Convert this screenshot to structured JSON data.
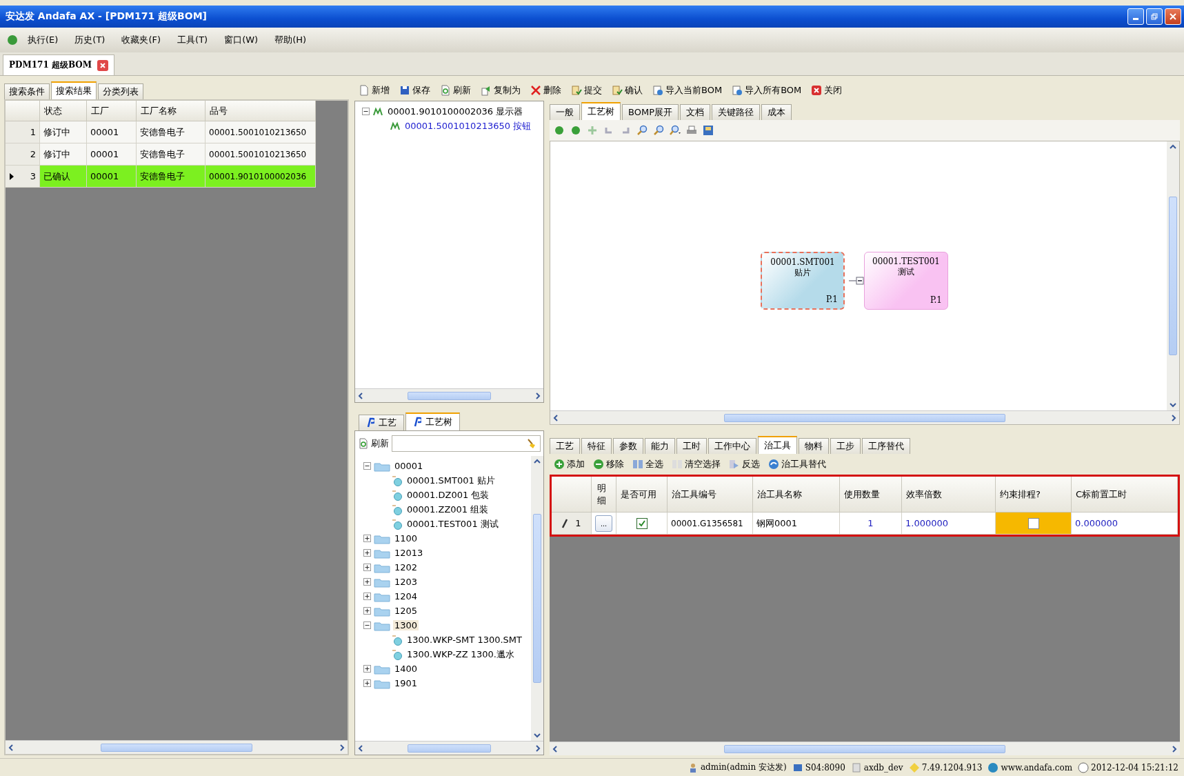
{
  "window": {
    "title": "安达发 Andafa AX - [PDM171 超级BOM]"
  },
  "menu": [
    {
      "label": "执行(E)"
    },
    {
      "label": "历史(T)"
    },
    {
      "label": "收藏夹(F)"
    },
    {
      "label": "工具(T)"
    },
    {
      "label": "窗口(W)"
    },
    {
      "label": "帮助(H)"
    }
  ],
  "doc_tabs": [
    {
      "label": "PDM171 超级BOM",
      "selected": true
    }
  ],
  "left_panel": {
    "tabs": [
      {
        "label": "搜索条件",
        "selected": false
      },
      {
        "label": "搜索结果",
        "selected": true
      },
      {
        "label": "分类列表",
        "selected": false
      }
    ],
    "table": {
      "columns": [
        "状态",
        "工厂",
        "工厂名称",
        "品号"
      ],
      "rows": [
        {
          "index": "1",
          "selected": false,
          "cells": [
            "修订中",
            "00001",
            "安德鲁电子",
            "00001.5001010213650"
          ]
        },
        {
          "index": "2",
          "selected": false,
          "cells": [
            "修订中",
            "00001",
            "安德鲁电子",
            "00001.5001010213650"
          ]
        },
        {
          "index": "3",
          "selected": true,
          "cells": [
            "已确认",
            "00001",
            "安德鲁电子",
            "00001.9010100002036"
          ]
        }
      ]
    }
  },
  "toolbar": [
    {
      "label": "新增"
    },
    {
      "label": "保存"
    },
    {
      "label": "刷新"
    },
    {
      "label": "复制为"
    },
    {
      "label": "删除"
    },
    {
      "label": "提交"
    },
    {
      "label": "确认"
    },
    {
      "label": "导入当前BOM"
    },
    {
      "label": "导入所有BOM"
    },
    {
      "label": "关闭"
    }
  ],
  "bom_tree": [
    {
      "label": "00001.9010100002036 显示器",
      "expanded": true,
      "selected": false,
      "children": [
        {
          "label": "00001.5001010213650 按钮",
          "selected": true
        }
      ]
    }
  ],
  "process_panel": {
    "tabs": [
      {
        "label": "工艺",
        "selected": false
      },
      {
        "label": "工艺树",
        "selected": true
      }
    ],
    "refresh_button": "刷新",
    "tree": [
      {
        "label": "00001",
        "expanded": true,
        "selected": false,
        "children": [
          {
            "label": "00001.SMT001 贴片",
            "selected": false
          },
          {
            "label": "00001.DZ001 包装",
            "selected": false
          },
          {
            "label": "00001.ZZ001 组装",
            "selected": false
          },
          {
            "label": "00001.TEST001 测试",
            "selected": false
          }
        ]
      },
      {
        "label": "1100",
        "expanded": false,
        "selected": false
      },
      {
        "label": "12013",
        "expanded": false,
        "selected": false
      },
      {
        "label": "1202",
        "expanded": false,
        "selected": false
      },
      {
        "label": "1203",
        "expanded": false,
        "selected": false
      },
      {
        "label": "1204",
        "expanded": false,
        "selected": false
      },
      {
        "label": "1205",
        "expanded": false,
        "selected": false
      },
      {
        "label": "1300",
        "expanded": true,
        "selected": true,
        "children": [
          {
            "label": "1300.WKP-SMT 1300.SMT",
            "selected": false
          },
          {
            "label": "1300.WKP-ZZ 1300.邋水",
            "selected": false
          }
        ]
      },
      {
        "label": "1400",
        "expanded": false,
        "selected": false
      },
      {
        "label": "1901",
        "expanded": false,
        "selected": false
      }
    ]
  },
  "detail_tabs": [
    {
      "label": "一般",
      "selected": false
    },
    {
      "label": "工艺树",
      "selected": true
    },
    {
      "label": "BOMP展开",
      "selected": false
    },
    {
      "label": "文档",
      "selected": false
    },
    {
      "label": "关键路径",
      "selected": false
    },
    {
      "label": "成本",
      "selected": false
    }
  ],
  "diagram": {
    "nodes": [
      {
        "code": "00001.SMT001",
        "name": "贴片",
        "page": "P.1",
        "color": "#b5dbea",
        "selected": true
      },
      {
        "code": "00001.TEST001",
        "name": "测试",
        "page": "P.1",
        "color": "#f9c2f2",
        "selected": false
      }
    ]
  },
  "operation_tabs": [
    {
      "label": "工艺",
      "selected": false
    },
    {
      "label": "特征",
      "selected": false
    },
    {
      "label": "参数",
      "selected": false
    },
    {
      "label": "能力",
      "selected": false
    },
    {
      "label": "工时",
      "selected": false
    },
    {
      "label": "工作中心",
      "selected": false
    },
    {
      "label": "治工具",
      "selected": true
    },
    {
      "label": "物料",
      "selected": false
    },
    {
      "label": "工步",
      "selected": false
    },
    {
      "label": "工序替代",
      "selected": false
    }
  ],
  "operation_toolbar": [
    {
      "label": "添加",
      "disabled": false
    },
    {
      "label": "移除",
      "disabled": false
    },
    {
      "label": "全选",
      "disabled": false
    },
    {
      "label": "清空选择",
      "disabled": false
    },
    {
      "label": "反选",
      "disabled": false
    },
    {
      "label": "治工具替代",
      "disabled": false
    }
  ],
  "tools_table": {
    "columns": [
      "明细",
      "是否可用",
      "治工具编号",
      "治工具名称",
      "使用数量",
      "效率倍数",
      "约束排程?",
      "C标前置工时"
    ],
    "rows": [
      {
        "index": "1",
        "detail": "...",
        "enabled": true,
        "code": "00001.G1356581",
        "name": "钢网0001",
        "quantity": "1",
        "factor": "1.000000",
        "constrained": false,
        "setup_time": "0.000000"
      }
    ]
  },
  "status_bar": [
    {
      "text": "admin(admin 安达发)"
    },
    {
      "text": "S04:8090"
    },
    {
      "text": "axdb_dev"
    },
    {
      "text": "7.49.1204.913"
    },
    {
      "text": "www.andafa.com"
    },
    {
      "text": "2012-12-04 15:21:12"
    }
  ]
}
